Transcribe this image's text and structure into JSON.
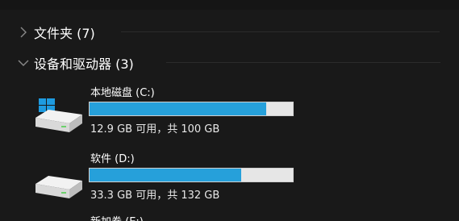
{
  "groups": {
    "folders": {
      "label": "文件夹 (7)",
      "expanded": false
    },
    "devices": {
      "label": "设备和驱动器 (3)",
      "expanded": true
    }
  },
  "drives": [
    {
      "name": "本地磁盘 (C:)",
      "free_text": "12.9 GB 可用，共 100 GB",
      "used_fraction": 0.871,
      "icon": "windows-system-drive-icon"
    },
    {
      "name": "软件 (D:)",
      "free_text": "33.3 GB 可用，共 132 GB",
      "used_fraction": 0.748,
      "icon": "hard-drive-icon"
    },
    {
      "name": "新加卷 (E:)",
      "icon": "hard-drive-icon"
    }
  ],
  "colors": {
    "background": "#191919",
    "bar_fill": "#26a0da",
    "bar_track": "#e6e6e6"
  }
}
